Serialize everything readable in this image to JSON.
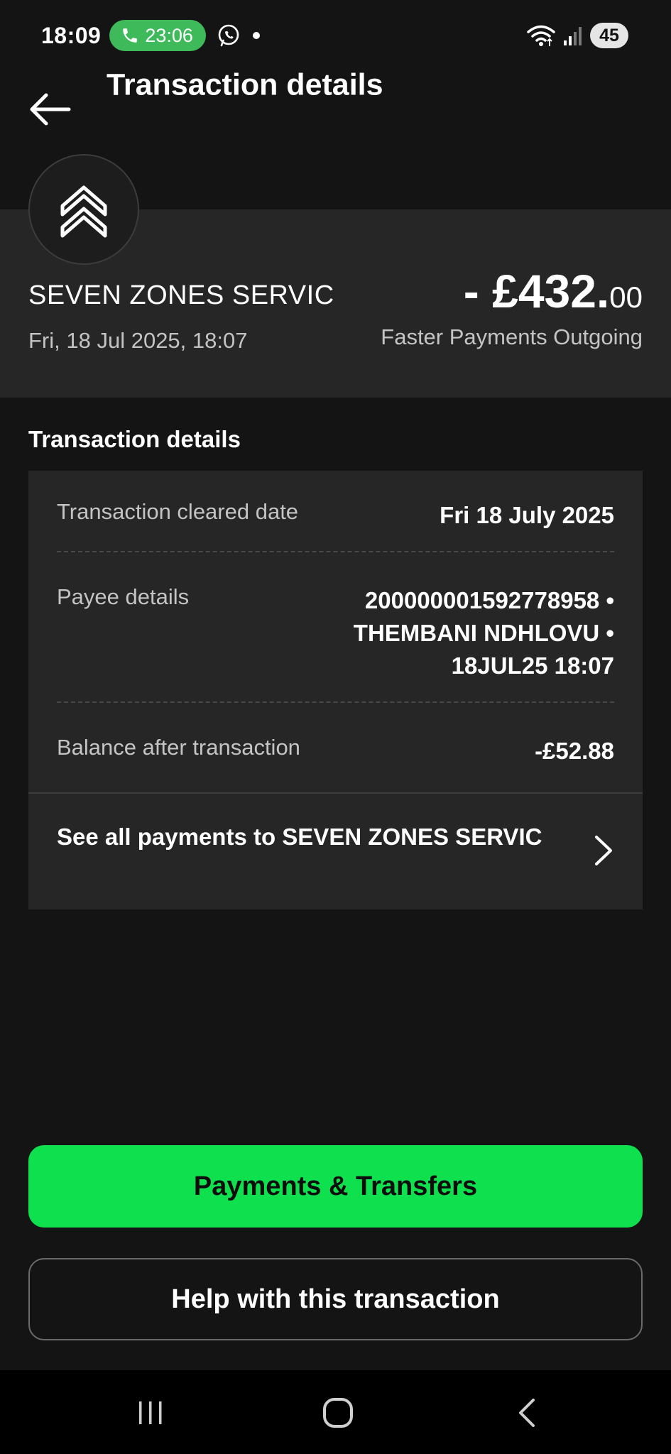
{
  "status_bar": {
    "time": "18:09",
    "call_duration": "23:06",
    "battery": "45",
    "icons": [
      "phone-icon",
      "whatsapp-icon",
      "notification-dot-icon",
      "wifi-icon",
      "signal-icon",
      "battery-icon"
    ]
  },
  "header": {
    "title": "Transaction details",
    "back_icon": "back-arrow-icon"
  },
  "summary": {
    "merchant_name": "SEVEN ZONES SERVIC",
    "datetime": "Fri, 18 Jul 2025, 18:07",
    "amount_main": "- £432.",
    "amount_cents": "00",
    "transaction_type": "Faster Payments Outgoing",
    "logo_icon": "double-chevron-up-icon"
  },
  "details": {
    "section_title": "Transaction details",
    "rows": [
      {
        "label": "Transaction cleared date",
        "value_lines": [
          "Fri 18 July 2025"
        ]
      },
      {
        "label": "Payee details",
        "value_lines": [
          "200000001592778958 •",
          "THEMBANI NDHLOVU •",
          "18JUL25 18:07"
        ]
      },
      {
        "label": "Balance after transaction",
        "value_lines": [
          "-£52.88"
        ]
      }
    ],
    "see_all_label": "See all payments to SEVEN ZONES SERVIC"
  },
  "actions": {
    "primary_label": "Payments & Transfers",
    "secondary_label": "Help with this transaction"
  },
  "colors": {
    "background": "#141414",
    "card": "#262626",
    "accent": "#0fe14e",
    "call_pill": "#3fba5a"
  },
  "nav_bar": {
    "icons": [
      "recent-apps-icon",
      "home-icon",
      "back-icon"
    ]
  }
}
